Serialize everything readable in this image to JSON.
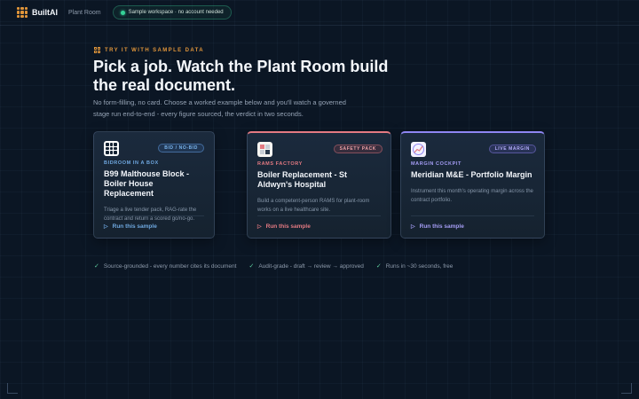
{
  "header": {
    "brand": "BuiltAI",
    "nav_link": "Plant Room",
    "workspace_pill": "Sample workspace · no account needed"
  },
  "hero": {
    "eyebrow": "TRY IT WITH SAMPLE DATA",
    "headline": "Pick a job. Watch the Plant Room build the real document.",
    "subtext": "No form-filling, no card. Choose a worked example below and you'll watch a governed stage run end-to-end - every figure sourced, the verdict in two seconds."
  },
  "cards": [
    {
      "badge": "BID / NO-BID",
      "category": "BIDROOM IN A BOX",
      "title": "B99 Malthouse Block - Boiler House Replacement",
      "description": "Triage a live tender pack, RAG-rate the contract and return a scored go/no-go.",
      "action": "Run this sample",
      "icon": "grid-icon",
      "accent": "#6fa8e0"
    },
    {
      "badge": "SAFETY PACK",
      "category": "RAMS FACTORY",
      "title": "Boiler Replacement - St Aldwyn's Hospital",
      "description": "Build a competent-person RAMS for plant-room works on a live healthcare site.",
      "action": "Run this sample",
      "icon": "rams-icon",
      "accent": "#e47a82"
    },
    {
      "badge": "LIVE MARGIN",
      "category": "MARGIN COCKPIT",
      "title": "Meridian M&E - Portfolio Margin",
      "description": "Instrument this month's operating margin across the contract portfolio.",
      "action": "Run this sample",
      "icon": "margin-chart-icon",
      "accent": "#8f86f2"
    }
  ],
  "features": [
    "Source-grounded - every number cites its document",
    "Audit-grade - draft → review → approved",
    "Runs in ~30 seconds, free"
  ]
}
